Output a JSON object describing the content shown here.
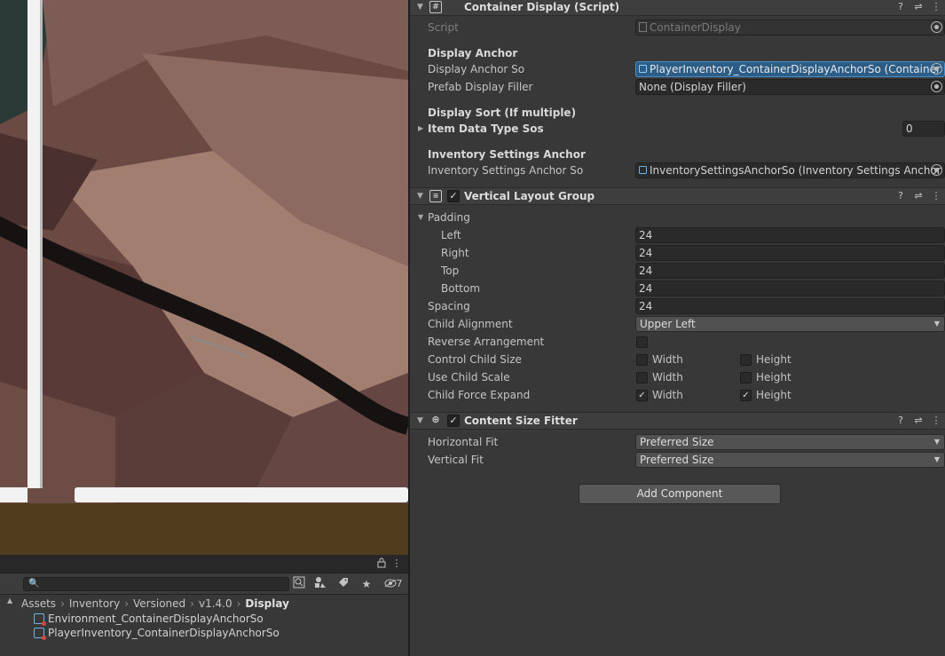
{
  "project": {
    "hidden_count": "7",
    "breadcrumbs": [
      "Assets",
      "Inventory",
      "Versioned",
      "v1.4.0",
      "Display"
    ],
    "assets": [
      "Environment_ContainerDisplayAnchorSo",
      "PlayerInventory_ContainerDisplayAnchorSo"
    ]
  },
  "inspector": {
    "container_display": {
      "title": "Container Display (Script)",
      "script_label": "Script",
      "script_value": "ContainerDisplay",
      "display_anchor_header": "Display Anchor",
      "display_anchor_so_label": "Display Anchor So",
      "display_anchor_so_value": "PlayerInventory_ContainerDisplayAnchorSo (Container Display Anchor So)",
      "prefab_filler_label": "Prefab Display Filler",
      "prefab_filler_value": "None (Display Filler)",
      "display_sort_header": "Display Sort (If multiple)",
      "item_data_type_label": "Item Data Type Sos",
      "item_data_type_value": "0",
      "inventory_settings_header": "Inventory Settings Anchor",
      "inventory_settings_label": "Inventory Settings Anchor So",
      "inventory_settings_value": "InventorySettingsAnchorSo (Inventory Settings Anchor So)"
    },
    "vertical_layout": {
      "title": "Vertical Layout Group",
      "padding_label": "Padding",
      "left_label": "Left",
      "left_value": "24",
      "right_label": "Right",
      "right_value": "24",
      "top_label": "Top",
      "top_value": "24",
      "bottom_label": "Bottom",
      "bottom_value": "24",
      "spacing_label": "Spacing",
      "spacing_value": "24",
      "child_alignment_label": "Child Alignment",
      "child_alignment_value": "Upper Left",
      "reverse_label": "Reverse Arrangement",
      "control_size_label": "Control Child Size",
      "use_scale_label": "Use Child Scale",
      "force_expand_label": "Child Force Expand",
      "width_label": "Width",
      "height_label": "Height"
    },
    "content_size_fitter": {
      "title": "Content Size Fitter",
      "horizontal_label": "Horizontal Fit",
      "horizontal_value": "Preferred Size",
      "vertical_label": "Vertical Fit",
      "vertical_value": "Preferred Size"
    },
    "add_component_label": "Add Component"
  },
  "colors": {
    "selection": "#2c5d87",
    "panel": "#383838",
    "header": "#3e3e3e",
    "field": "#2a2a2a"
  }
}
